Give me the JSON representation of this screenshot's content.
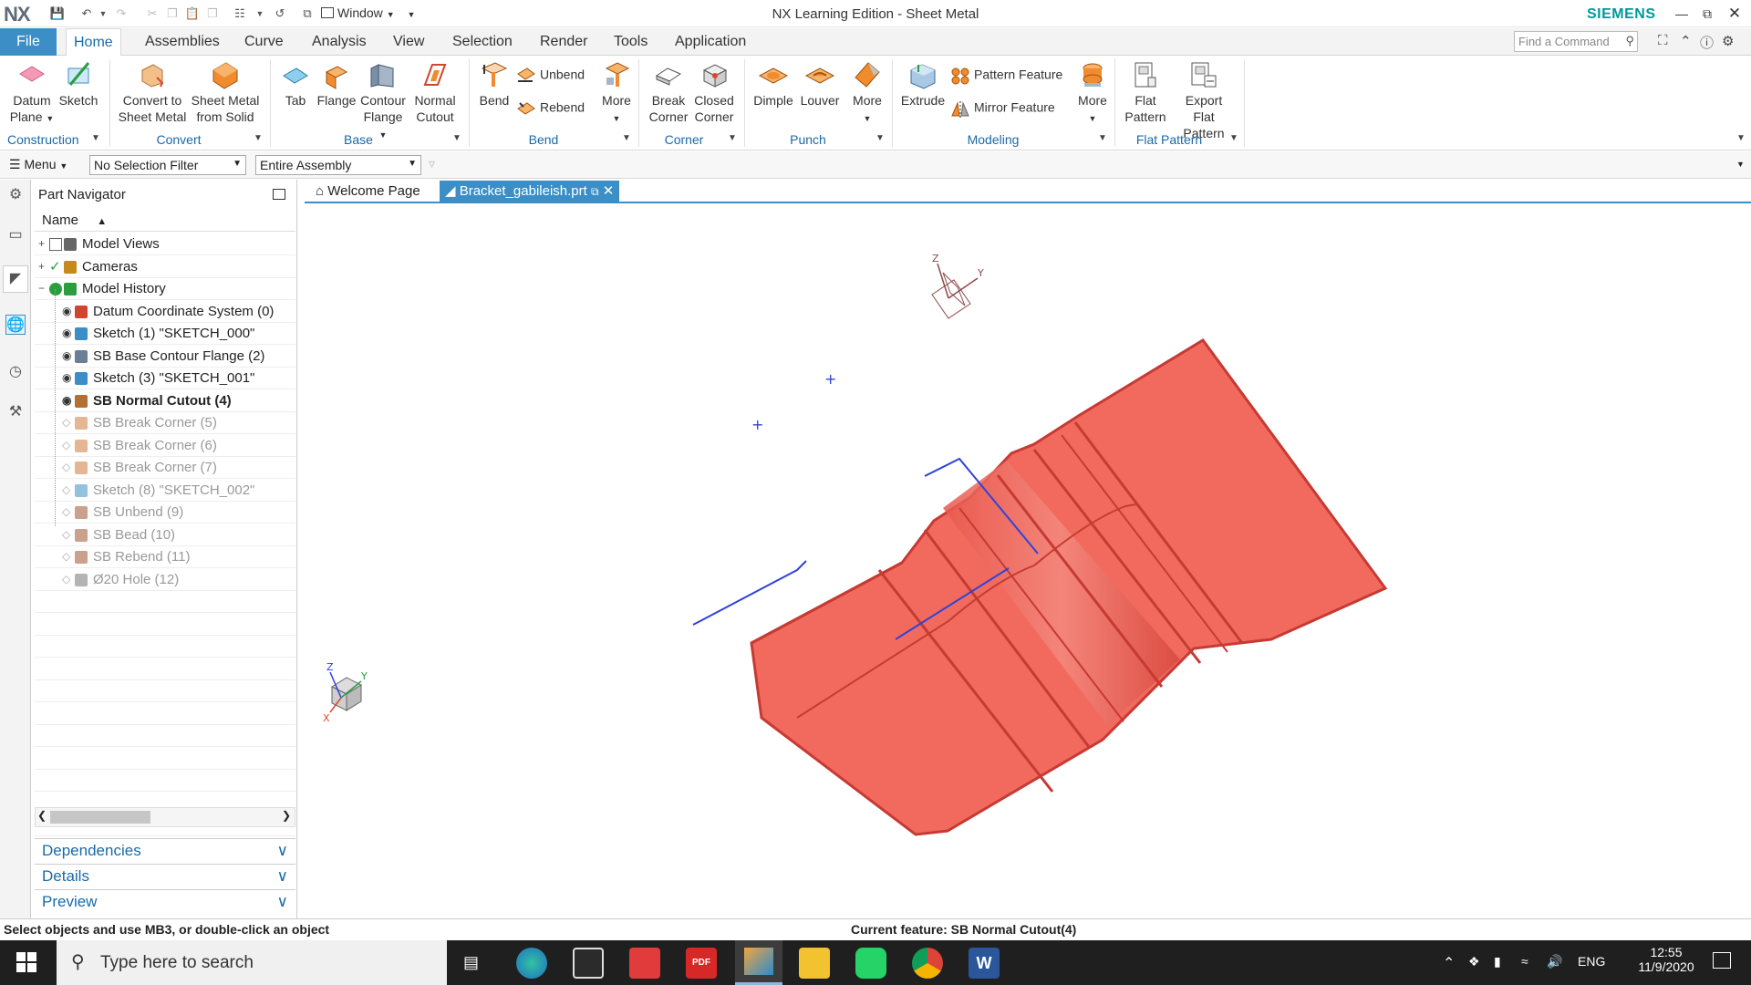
{
  "titlebar": {
    "logo": "NX",
    "window_menu": "Window",
    "title": "NX Learning Edition - Sheet Metal",
    "brand": "SIEMENS"
  },
  "tabs": {
    "file": "File",
    "items": [
      "Home",
      "Assemblies",
      "Curve",
      "Analysis",
      "View",
      "Selection",
      "Render",
      "Tools",
      "Application"
    ],
    "find_placeholder": "Find a Command"
  },
  "ribbon": {
    "datum_plane": "Datum Plane",
    "sketch": "Sketch",
    "construction": "Construction",
    "convert_to_sheet_metal": "Convert to Sheet Metal",
    "sheet_metal_from_solid": "Sheet Metal from Solid",
    "convert": "Convert",
    "tab": "Tab",
    "flange": "Flange",
    "contour_flange": "Contour Flange",
    "normal_cutout": "Normal Cutout",
    "base": "Base",
    "bend": "Bend",
    "unbend": "Unbend",
    "rebend": "Rebend",
    "more": "More",
    "bend_group": "Bend",
    "break_corner": "Break Corner",
    "closed_corner": "Closed Corner",
    "corner": "Corner",
    "dimple": "Dimple",
    "louver": "Louver",
    "punch": "Punch",
    "extrude": "Extrude",
    "pattern_feature": "Pattern Feature",
    "mirror_feature": "Mirror Feature",
    "modeling": "Modeling",
    "flat_pattern": "Flat Pattern",
    "export_flat_pattern": "Export Flat Pattern",
    "flat_pattern_group": "Flat Pattern"
  },
  "selbar": {
    "menu": "Menu",
    "filter": "No Selection Filter",
    "scope": "Entire Assembly"
  },
  "navigator": {
    "title": "Part Navigator",
    "column_name": "Name",
    "rows": [
      {
        "label": "Model Views",
        "state": "normal"
      },
      {
        "label": "Cameras",
        "state": "normal"
      },
      {
        "label": "Model History",
        "state": "normal"
      },
      {
        "label": "Datum Coordinate System (0)",
        "state": "normal"
      },
      {
        "label": "Sketch (1) \"SKETCH_000\"",
        "state": "normal"
      },
      {
        "label": "SB Base Contour Flange (2)",
        "state": "normal"
      },
      {
        "label": "Sketch (3) \"SKETCH_001\"",
        "state": "normal"
      },
      {
        "label": "SB Normal Cutout (4)",
        "state": "current"
      },
      {
        "label": "SB Break Corner (5)",
        "state": "suppressed"
      },
      {
        "label": "SB Break Corner (6)",
        "state": "suppressed"
      },
      {
        "label": "SB Break Corner (7)",
        "state": "suppressed"
      },
      {
        "label": "Sketch (8) \"SKETCH_002\"",
        "state": "suppressed"
      },
      {
        "label": "SB Unbend (9)",
        "state": "suppressed"
      },
      {
        "label": "SB Bead (10)",
        "state": "suppressed"
      },
      {
        "label": "SB Rebend (11)",
        "state": "suppressed"
      },
      {
        "label": "Ø20 Hole (12)",
        "state": "suppressed"
      }
    ],
    "panels": [
      "Dependencies",
      "Details",
      "Preview"
    ]
  },
  "doctabs": {
    "welcome": "Welcome Page",
    "part": "Bracket_gabileish.prt"
  },
  "triad": {
    "x": "X",
    "y": "Y",
    "z": "Z"
  },
  "status": {
    "prompt": "Select objects and use MB3, or double-click an object",
    "current_feature": "Current feature: SB Normal Cutout(4)"
  },
  "taskbar": {
    "search_placeholder": "Type here to search",
    "lang": "ENG",
    "time": "12:55",
    "date": "11/9/2020",
    "pdf_label": "PDF"
  },
  "colors": {
    "accent": "#3b8fc6",
    "part_fill": "#f26a5e",
    "part_edge": "#c63a33",
    "siemens": "#009999"
  }
}
